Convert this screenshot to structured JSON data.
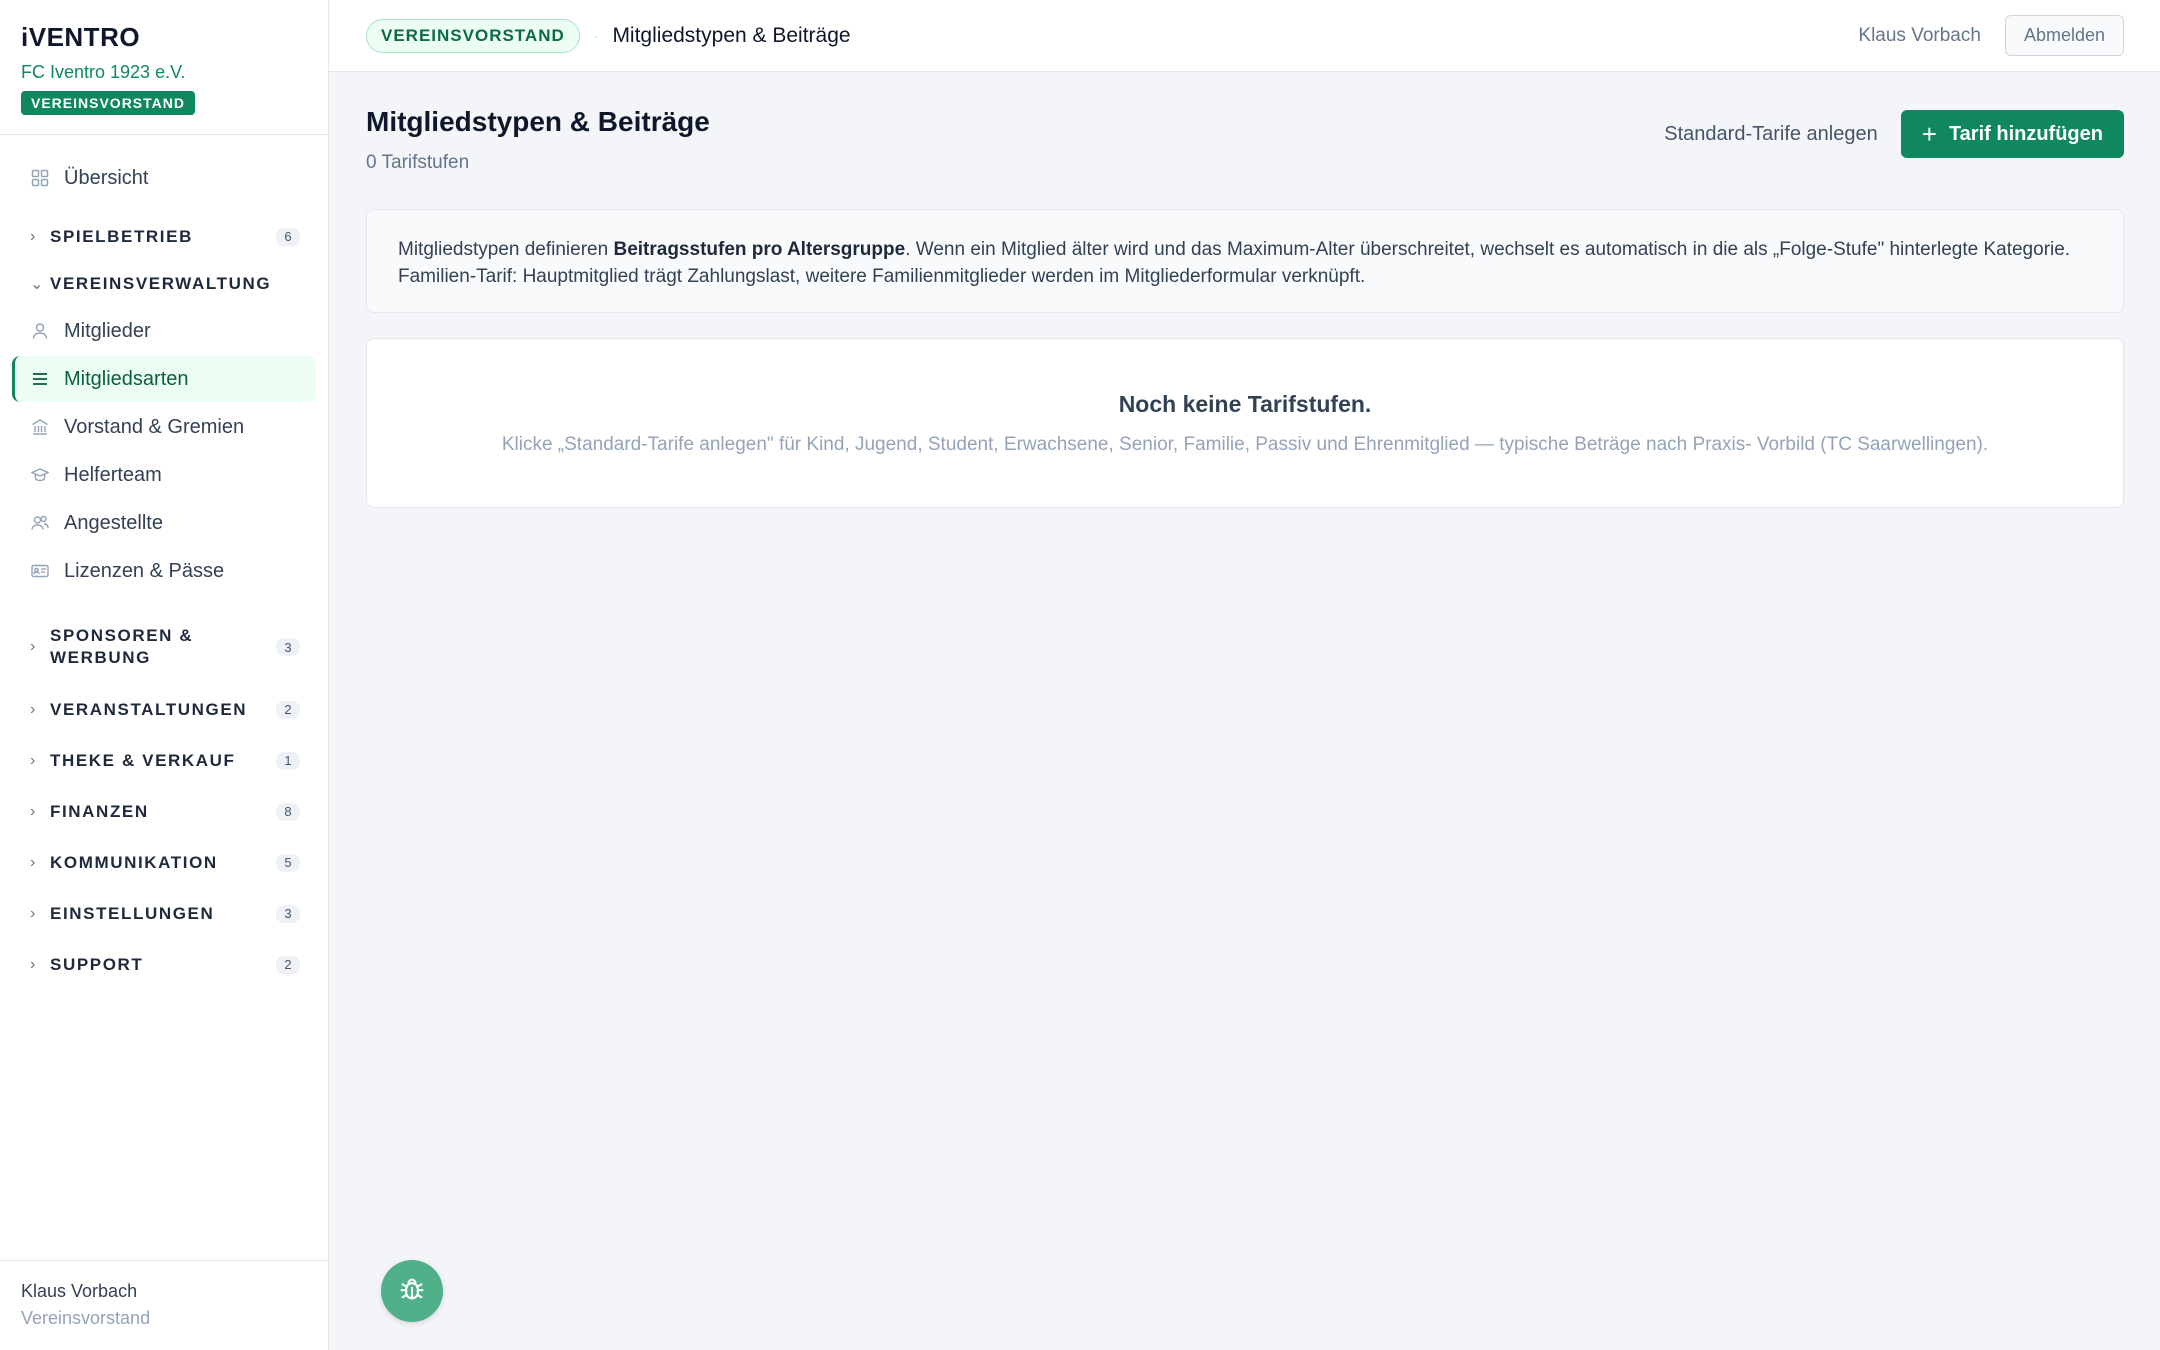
{
  "brand": {
    "logo": "iVENTRO",
    "club": "FC Iventro 1923 e.V.",
    "role_badge": "VEREINSVORSTAND"
  },
  "nav": {
    "overview": {
      "label": "Übersicht",
      "icon": "grid-icon"
    },
    "sections": [
      {
        "label": "SPIELBETRIEB",
        "count": "6",
        "expanded": false
      },
      {
        "label": "VEREINSVERWALTUNG",
        "expanded": true
      },
      {
        "label": "SPONSOREN & WERBUNG",
        "count": "3",
        "expanded": false
      },
      {
        "label": "VERANSTALTUNGEN",
        "count": "2",
        "expanded": false
      },
      {
        "label": "THEKE & VERKAUF",
        "count": "1",
        "expanded": false
      },
      {
        "label": "FINANZEN",
        "count": "8",
        "expanded": false
      },
      {
        "label": "KOMMUNIKATION",
        "count": "5",
        "expanded": false
      },
      {
        "label": "EINSTELLUNGEN",
        "count": "3",
        "expanded": false
      },
      {
        "label": "SUPPORT",
        "count": "2",
        "expanded": false
      }
    ],
    "vereinsverwaltung_items": [
      {
        "label": "Mitglieder",
        "icon": "user-icon"
      },
      {
        "label": "Mitgliedsarten",
        "icon": "list-icon",
        "active": true
      },
      {
        "label": "Vorstand & Gremien",
        "icon": "building-icon"
      },
      {
        "label": "Helferteam",
        "icon": "graduation-cap-icon"
      },
      {
        "label": "Angestellte",
        "icon": "users-icon"
      },
      {
        "label": "Lizenzen & Pässe",
        "icon": "id-card-icon"
      }
    ]
  },
  "sidebar_footer": {
    "name": "Klaus Vorbach",
    "role": "Vereinsvorstand"
  },
  "topbar": {
    "badge": "VEREINSVORSTAND",
    "separator": "·",
    "title": "Mitgliedstypen & Beiträge",
    "user": "Klaus Vorbach",
    "logout": "Abmelden"
  },
  "page": {
    "title": "Mitgliedstypen & Beiträge",
    "subtitle": "0 Tarifstufen",
    "secondary_action": "Standard-Tarife anlegen",
    "primary_action": "Tarif hinzufügen",
    "info_prefix": "Mitgliedstypen definieren ",
    "info_bold": "Beitragsstufen pro Altersgruppe",
    "info_rest": ". Wenn ein Mitglied älter wird und das Maximum-Alter überschreitet, wechselt es automatisch in die als „Folge-Stufe\" hinterlegte Kategorie. Familien-Tarif: Hauptmitglied trägt Zahlungslast, weitere Familienmitglieder werden im Mitgliederformular verknüpft.",
    "empty_title": "Noch keine Tarifstufen.",
    "empty_text": "Klicke „Standard-Tarife anlegen\" für Kind, Jugend, Student, Erwachsene, Senior, Familie, Passiv und Ehrenmitglied — typische Beträge nach Praxis- Vorbild (TC Saarwellingen)."
  },
  "colors": {
    "accent": "#10875d",
    "fab": "#4fb08a"
  },
  "fab_icon": "bug-icon"
}
